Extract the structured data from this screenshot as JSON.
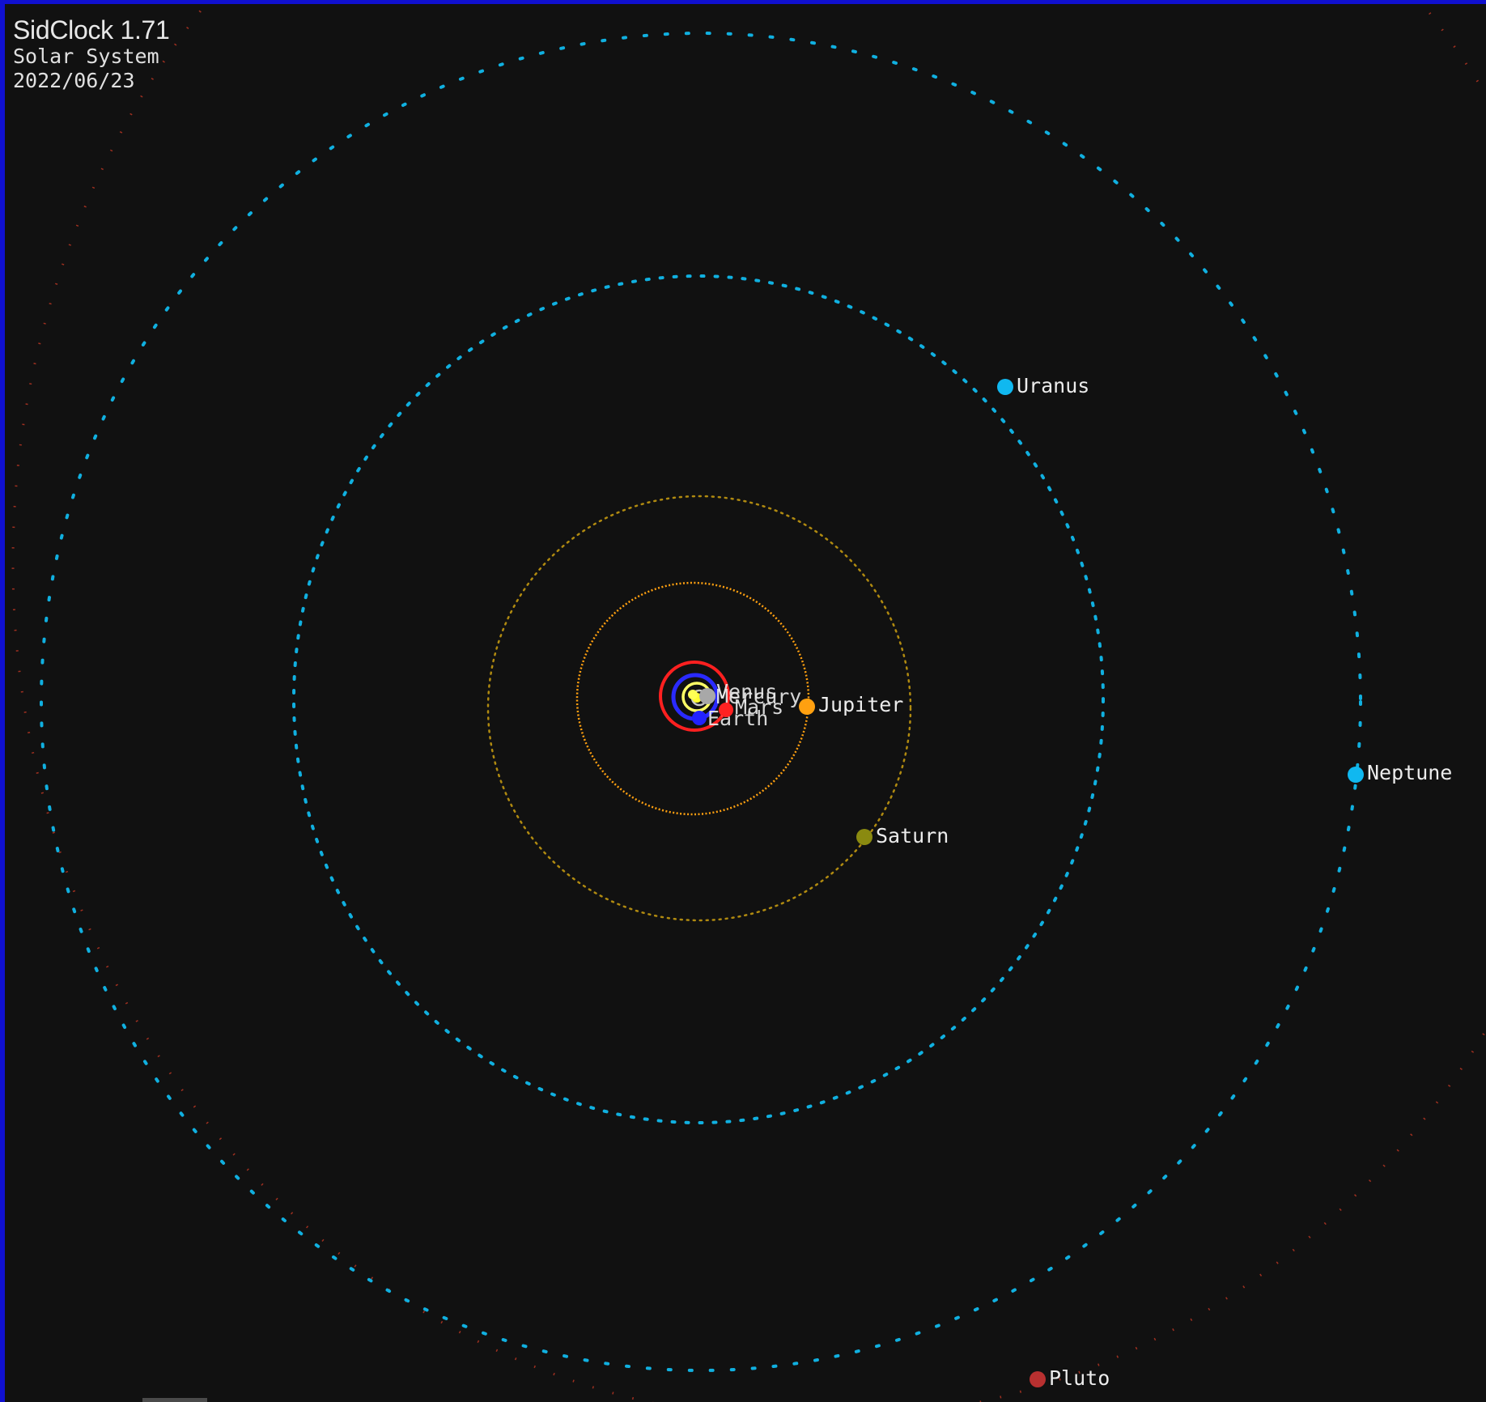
{
  "header": {
    "title": "SidClock 1.71",
    "subtitle": "Solar System",
    "date": "2022/06/23"
  },
  "colors": {
    "background": "#111111",
    "window_border": "#1010d0",
    "label_text": "#ececec",
    "sun": "#ffff33"
  },
  "planets": [
    {
      "name": "Mercury",
      "label": "Mercury",
      "color": "#a8a8a8",
      "orbit_color": "#c8c8c8"
    },
    {
      "name": "Venus",
      "label": "Venus",
      "color": "#ffff55",
      "orbit_color": "#ffff66"
    },
    {
      "name": "Earth",
      "label": "Earth",
      "color": "#2222ff",
      "orbit_color": "#2a2aff"
    },
    {
      "name": "Mars",
      "label": "Mars",
      "color": "#ff2222",
      "orbit_color": "#ff2020"
    },
    {
      "name": "Jupiter",
      "label": "Jupiter",
      "color": "#ffa010",
      "orbit_color": "#ffa010"
    },
    {
      "name": "Saturn",
      "label": "Saturn",
      "color": "#8a8a10",
      "orbit_color": "#b08a10"
    },
    {
      "name": "Uranus",
      "label": "Uranus",
      "color": "#10b8f0",
      "orbit_color": "#10b0e0"
    },
    {
      "name": "Neptune",
      "label": "Neptune",
      "color": "#10b8f0",
      "orbit_color": "#10b0e0"
    },
    {
      "name": "Pluto",
      "label": "Pluto",
      "color": "#b83030",
      "orbit_color": "#a03020"
    }
  ]
}
